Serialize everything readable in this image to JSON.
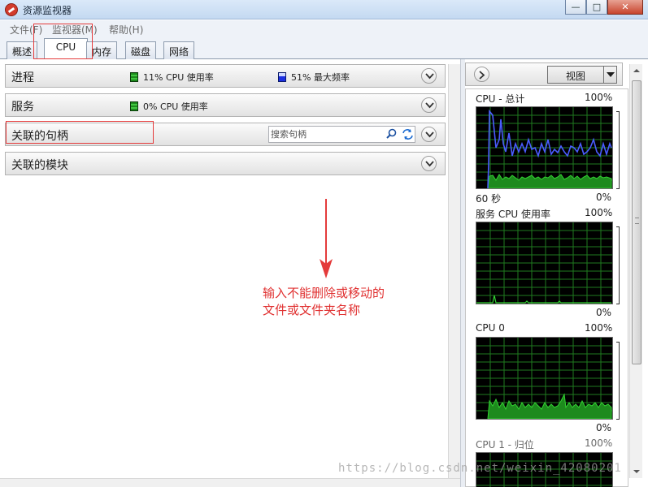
{
  "window": {
    "title": "资源监视器",
    "buttons": {
      "minimize": "—",
      "maximize": "□",
      "close": "✕"
    }
  },
  "menu": {
    "items": [
      {
        "label": "文件(F)"
      },
      {
        "label": "监视器(M)"
      },
      {
        "label": "帮助(H)"
      }
    ]
  },
  "tabs": [
    {
      "label": "概述",
      "active": false
    },
    {
      "label": "CPU",
      "active": true
    },
    {
      "label": "内存",
      "active": false
    },
    {
      "label": "磁盘",
      "active": false
    },
    {
      "label": "网络",
      "active": false
    }
  ],
  "sections": {
    "processes": {
      "title": "进程",
      "cpu_usage": "11% CPU 使用率",
      "max_frequency": "51% 最大频率"
    },
    "services": {
      "title": "服务",
      "cpu_usage": "0% CPU 使用率"
    },
    "handles": {
      "title": "关联的句柄",
      "search_placeholder": "搜索句柄"
    },
    "modules": {
      "title": "关联的模块"
    }
  },
  "annotation": {
    "text_line1": "输入不能删除或移动的",
    "text_line2": "文件或文件夹名称",
    "color": "#e03030"
  },
  "right_panel": {
    "view_button": "视图",
    "graphs": [
      {
        "title": "CPU - 总计",
        "max": "100%",
        "footer_left": "60 秒",
        "footer_right": "0%"
      },
      {
        "title": "服务 CPU 使用率",
        "max": "100%",
        "footer_right": "0%"
      },
      {
        "title": "CPU 0",
        "max": "100%",
        "footer_right": "0%"
      },
      {
        "title": "CPU 1 - 归位",
        "max": "100%"
      }
    ]
  },
  "colors": {
    "graph_green": "#32d232",
    "graph_blue": "#4a5cff",
    "graph_grid": "#1f7a1f",
    "red_annotation": "#e43b3b"
  },
  "watermark": "https://blog.csdn.net/weixin_42080201"
}
